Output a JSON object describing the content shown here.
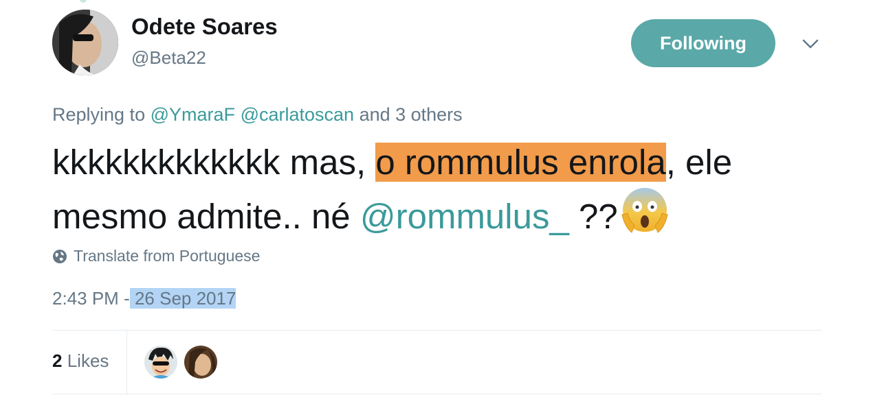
{
  "author": {
    "name": "Odete Soares",
    "handle": "@Beta22"
  },
  "follow_button": {
    "label": "Following",
    "color": "#5aa8a8"
  },
  "caret": {
    "icon": "chevron-down-icon"
  },
  "replying": {
    "prefix": "Replying to",
    "mentions": [
      "@YmaraF",
      "@carlatoscan"
    ],
    "suffix": "and 3 others"
  },
  "tweet": {
    "part1": "kkkkkkkkkkkkk mas, ",
    "highlight": "o rommulus enrola",
    "part2": ", ele mesmo admite.. né ",
    "mention": "@rommulus_",
    "part3": " ??",
    "emoji_icon": "face-screaming-in-fear-icon"
  },
  "translate": {
    "label": "Translate from Portuguese",
    "icon": "globe-icon"
  },
  "timestamp": {
    "time": "2:43 PM",
    "separator": "-",
    "date": "26 Sep 2017"
  },
  "likes": {
    "count": "2",
    "label": "Likes"
  },
  "likers": [
    "liker-avatar-1",
    "liker-avatar-2"
  ],
  "colors": {
    "accent": "#3b9a9a",
    "highlight": "#f29b4a",
    "selection": "#b3d4f5",
    "secondary_text": "#657786"
  }
}
